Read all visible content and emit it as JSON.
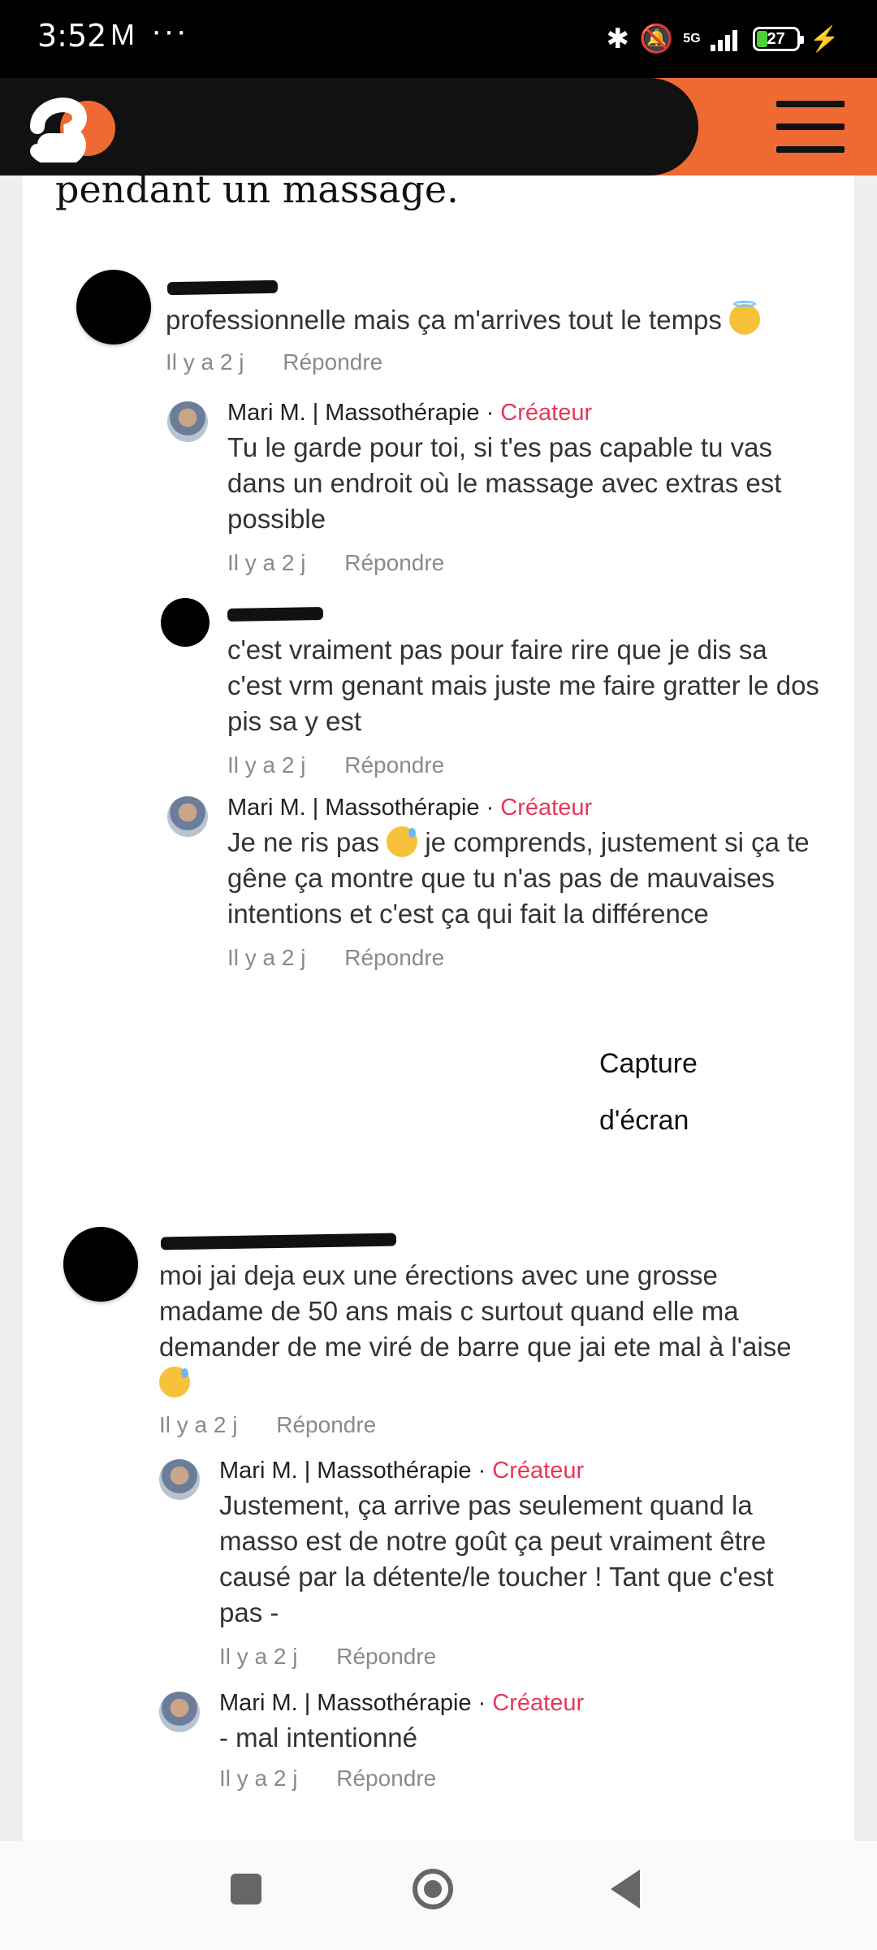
{
  "status_bar": {
    "time": "3:52",
    "network": "5G",
    "battery": "27",
    "battery_level_pct": 27,
    "icons": [
      "gmail-icon",
      "more-icon",
      "bluetooth-icon",
      "bell-off-icon",
      "signal-icon",
      "battery-icon",
      "charging-icon"
    ]
  },
  "header": {
    "accent_color": "#ee6a32",
    "logo_icon": "logo-34-icon",
    "menu_icon": "hamburger-menu-icon"
  },
  "article": {
    "text_fragment": "pendant un massage."
  },
  "comments": [
    {
      "text": "professionnelle mais ça m'arrives tout le temps",
      "emoji": "smiling-face-with-halo-icon",
      "time": "Il y a 2 j",
      "reply": "Répondre"
    },
    {
      "author": "Mari M. | Massothérapie · ",
      "creator": "Créateur",
      "text": "Tu le garde pour toi, si t'es pas capable tu vas dans un endroit où le massage avec extras est possible",
      "time": "Il y a 2 j",
      "reply": "Répondre"
    },
    {
      "text": "c'est vraiment pas pour faire rire que je dis sa c'est vrm genant mais juste me faire gratter le dos pis sa y est",
      "time": "Il y a 2 j",
      "reply": "Répondre"
    },
    {
      "author": "Mari M. | Massothérapie · ",
      "creator": "Créateur",
      "text_a": "Je ne ris pas ",
      "text_b": " je comprends, justement si ça te gêne ça montre que tu n'as pas de mauvaises intentions et c'est ça qui fait la différence",
      "emoji": "grinning-sweat-icon",
      "time": "Il y a 2 j",
      "reply": "Répondre"
    },
    {
      "text": "moi jai deja eux une érections avec une grosse madame de 50 ans mais c surtout quand elle ma demander de me viré de barre que jai ete mal à l'aise",
      "emoji": "grinning-sweat-icon",
      "time": "Il y a 2 j",
      "reply": "Répondre"
    },
    {
      "author": "Mari M. | Massothérapie · ",
      "creator": "Créateur",
      "text": "Justement, ça arrive pas seulement quand la masso est de notre goût ça peut vraiment être causé par la détente/le toucher ! Tant que c'est pas -",
      "time": "Il y a 2 j",
      "reply": "Répondre"
    },
    {
      "author": "Mari M. | Massothérapie · ",
      "creator": "Créateur",
      "text": "- mal intentionné",
      "time": "Il y a 2 j",
      "reply": "Répondre"
    }
  ],
  "capture_label": {
    "line1": "Capture",
    "line2": "d'écran"
  },
  "nav": {
    "icons": [
      "recents-square-icon",
      "home-circle-icon",
      "back-triangle-icon"
    ]
  }
}
